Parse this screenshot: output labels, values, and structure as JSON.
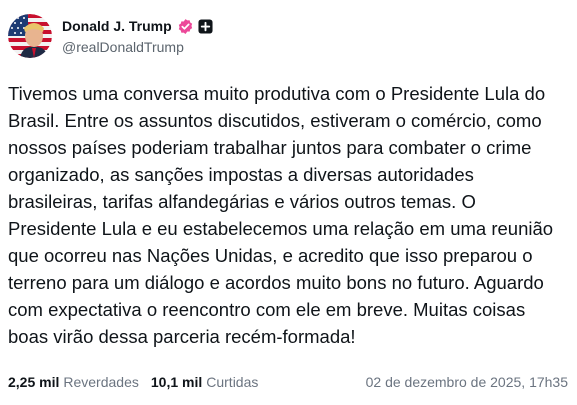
{
  "post": {
    "author": {
      "display_name": "Donald J. Trump",
      "handle": "@realDonaldTrump",
      "verified_icon": "verified-badge-icon",
      "verified_color": "#ec4899",
      "plus_icon": "plus-square-icon",
      "avatar_icon": "american-flag-portrait-avatar"
    },
    "text": "Tivemos uma conversa muito produtiva com o Presidente Lula do\nBrasil. Entre os assuntos discutidos, estiveram o comércio, como\nnossos países poderiam trabalhar juntos para combater o crime\norganizado, as sanções impostas a diversas autoridades\nbrasileiras, tarifas alfandegárias e vários outros temas. O\nPresidente Lula e eu estabelecemos uma relação em uma reunião\nque ocorreu nas Nações Unidas, e acredito que isso preparou o\nterreno para um diálogo e acordos muito bons no futuro. Aguardo\ncom expectativa o reencontro com ele em breve. Muitas coisas\nboas virão dessa parceria recém-formada!",
    "stats": {
      "reposts_count": "2,25 mil",
      "reposts_label": "Reverdades",
      "likes_count": "10,1 mil",
      "likes_label": "Curtidas"
    },
    "timestamp": "02 de dezembro de 2025, 17h35"
  }
}
